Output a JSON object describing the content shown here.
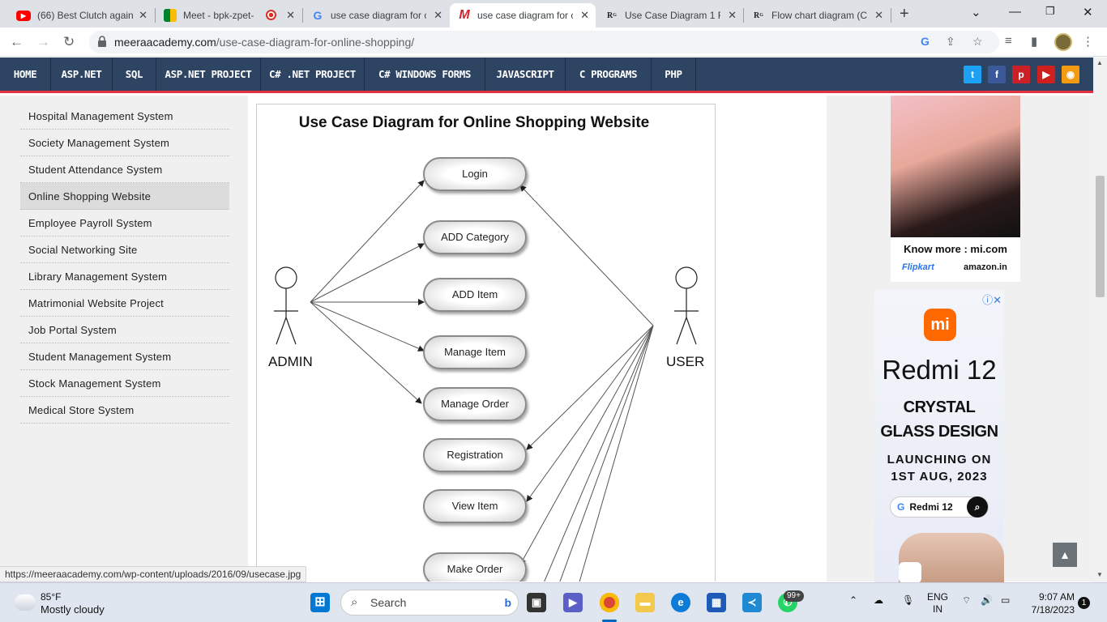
{
  "tabs": [
    {
      "title": "(66) Best Clutch agains",
      "icon": "youtube-icon"
    },
    {
      "title": "Meet - bpk-zpet-a",
      "icon": "meet-icon"
    },
    {
      "title": "use case diagram for c",
      "icon": "google-icon"
    },
    {
      "title": "use case diagram for c",
      "icon": "meera-icon"
    },
    {
      "title": "Use Case Diagram 1 F",
      "icon": "rg-icon"
    },
    {
      "title": "Flow chart diagram (C",
      "icon": "rg-icon"
    }
  ],
  "address": {
    "domain": "meeraacademy.com",
    "path": "/use-case-diagram-for-online-shopping/"
  },
  "nav": [
    "HOME",
    "ASP.NET",
    "SQL",
    "ASP.NET PROJECT",
    "C# .NET PROJECT",
    "C# WINDOWS FORMS",
    "JAVASCRIPT",
    "C PROGRAMS",
    "PHP"
  ],
  "sidebar": [
    "Hospital Management System",
    "Society Management System",
    "Student Attendance System",
    "Online Shopping Website",
    "Employee Payroll System",
    "Social Networking Site",
    "Library Management System",
    "Matrimonial Website Project",
    "Job Portal System",
    "Student Management System",
    "Stock Management System",
    "Medical Store System"
  ],
  "diagram": {
    "title": "Use Case Diagram for Online Shopping Website",
    "actors": [
      "ADMIN",
      "USER"
    ],
    "use_cases": [
      "Login",
      "ADD Category",
      "ADD Item",
      "Manage Item",
      "Manage Order",
      "Registration",
      "View Item",
      "Make Order"
    ]
  },
  "ad1": {
    "tagline": "Know more : mi.com",
    "flipkart": "Flipkart",
    "amazon": "amazon.in"
  },
  "ad2": {
    "brand": "mi",
    "title": "Redmi 12",
    "line1": "CRYSTAL",
    "line2": "GLASS DESIGN",
    "launch1": "LAUNCHING ON",
    "launch2": "1ST AUG, 2023",
    "search": "Redmi 12"
  },
  "status_url": "https://meeraacademy.com/wp-content/uploads/2016/09/usecase.jpg",
  "taskbar": {
    "weather_temp": "85°F",
    "weather_desc": "Mostly cloudy",
    "search": "Search",
    "lang1": "ENG",
    "lang2": "IN",
    "time": "9:07 AM",
    "date": "7/18/2023",
    "notif_count": "1",
    "whatsapp_badge": "99+"
  }
}
